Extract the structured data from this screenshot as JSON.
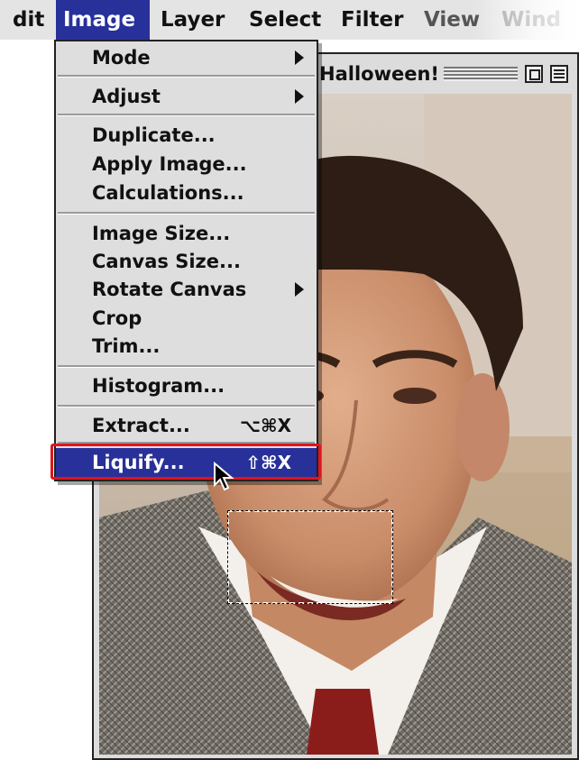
{
  "menubar": {
    "items": [
      "dit",
      "Image",
      "Layer",
      "Select",
      "Filter",
      "View",
      "Wind"
    ],
    "active_index": 1
  },
  "document": {
    "title": "Halloween!"
  },
  "image_menu": {
    "items": [
      {
        "label": "Mode",
        "submenu": true
      },
      {
        "label": "Adjust",
        "submenu": true
      },
      {
        "label": "Duplicate..."
      },
      {
        "label": "Apply Image..."
      },
      {
        "label": "Calculations..."
      },
      {
        "label": "Image Size..."
      },
      {
        "label": "Canvas Size..."
      },
      {
        "label": "Rotate Canvas",
        "submenu": true
      },
      {
        "label": "Crop"
      },
      {
        "label": "Trim..."
      },
      {
        "label": "Histogram..."
      },
      {
        "label": "Extract...",
        "shortcut": "⌥⌘X"
      },
      {
        "label": "Liquify...",
        "shortcut": "⇧⌘X",
        "highlighted": true
      }
    ]
  },
  "colors": {
    "menu_highlight": "#28309a",
    "callout_outline": "#e0141e"
  },
  "icons": {
    "cursor": "arrow-cursor-icon",
    "zoom": "zoom-box-icon",
    "collapse": "collapse-box-icon",
    "submenu": "submenu-arrow-icon"
  }
}
